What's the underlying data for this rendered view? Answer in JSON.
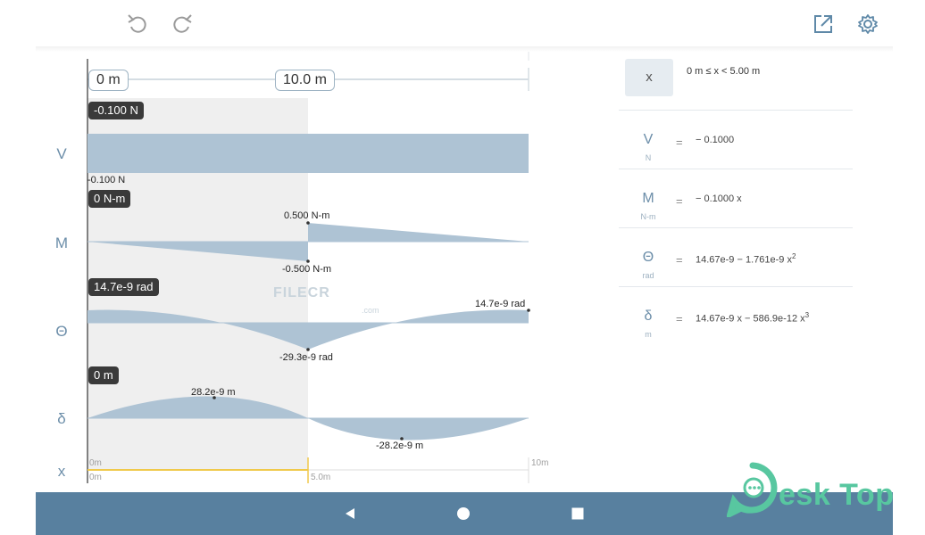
{
  "toolbar": {
    "undo_icon": "undo-icon",
    "redo_icon": "redo-icon",
    "share_icon": "share-icon",
    "settings_icon": "gear-icon"
  },
  "beam": {
    "start_label": "0 m",
    "end_label": "10.0 m"
  },
  "rows": {
    "shear": {
      "label": "V",
      "badge": "-0.100 N",
      "marks": [
        "-0.100 N"
      ]
    },
    "moment": {
      "label": "M",
      "badge": "0 N-m",
      "marks": [
        "0.500 N-m",
        "-0.500 N-m"
      ]
    },
    "rotation": {
      "label": "Θ",
      "badge": "14.7e-9 rad",
      "marks": [
        "14.7e-9 rad",
        "-29.3e-9 rad"
      ]
    },
    "deflection": {
      "label": "δ",
      "badge": "0 m",
      "marks": [
        "28.2e-9 m",
        "-28.2e-9 m"
      ]
    },
    "x_axis": {
      "label": "x",
      "ticks_top": [
        "0m",
        "10m"
      ],
      "ticks_bottom": [
        "0m",
        "5.0m"
      ]
    }
  },
  "panel": {
    "x_button": "x",
    "range": "0 m ≤ x < 5.00 m",
    "equations": [
      {
        "symbol": "V",
        "unit": "N",
        "eq": "=",
        "expr": "− 0.1000"
      },
      {
        "symbol": "M",
        "unit": "N-m",
        "eq": "=",
        "expr": "− 0.1000 x"
      },
      {
        "symbol": "Θ",
        "unit": "rad",
        "eq": "=",
        "expr": "14.67e-9 − 1.761e-9 x",
        "sup": "2"
      },
      {
        "symbol": "δ",
        "unit": "m",
        "eq": "=",
        "expr": "14.67e-9 x − 586.9e-12 x",
        "sup": "3"
      }
    ]
  },
  "watermarks": {
    "filecr": "FILECR",
    "filecr_suffix": ".com",
    "desktop": "esk Top"
  },
  "navbar": {
    "back_icon": "back-triangle-icon",
    "home_icon": "home-circle-icon",
    "recents_icon": "recents-square-icon"
  },
  "colors": {
    "fill": "#aec3d4",
    "selected_region": "#efefef",
    "axis_highlight": "#f0c94a",
    "navbar": "#58809f",
    "label": "#6c8ea9"
  }
}
